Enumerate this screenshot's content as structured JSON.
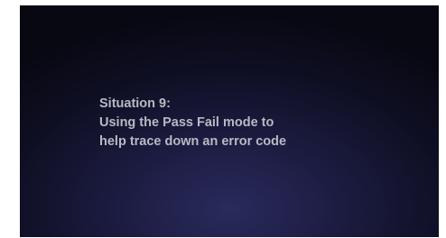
{
  "slide": {
    "lines": [
      "Situation 9:",
      "Using the Pass Fail mode to",
      "help trace down an error code"
    ]
  }
}
